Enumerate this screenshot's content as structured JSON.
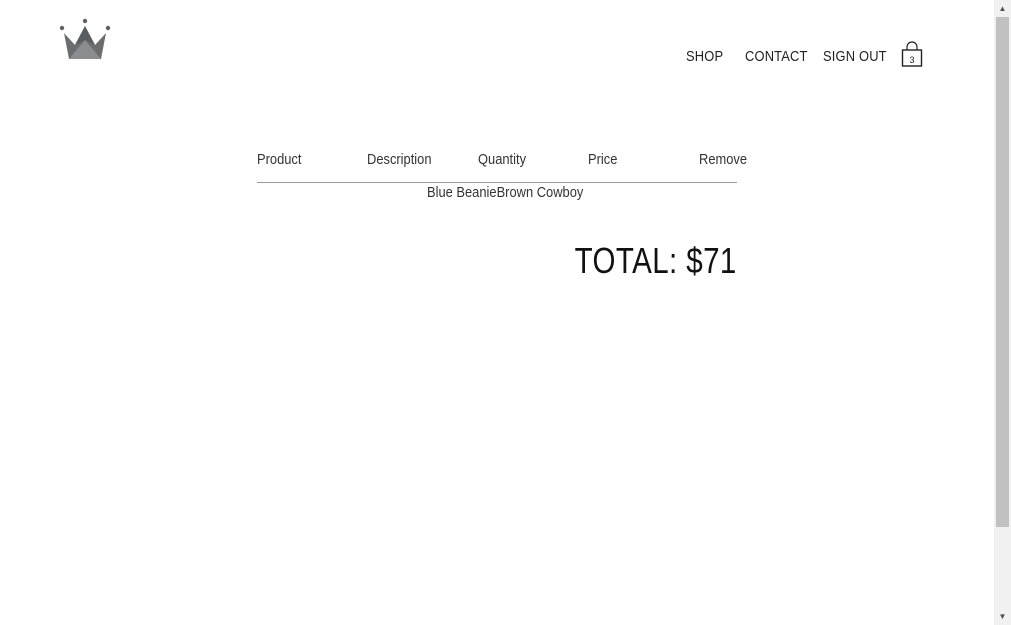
{
  "header": {
    "logo_icon": "crown-icon",
    "nav": {
      "shop": "SHOP",
      "contact": "CONTACT",
      "sign_out": "SIGN OUT"
    },
    "cart": {
      "icon": "shopping-bag-icon",
      "count": "3"
    }
  },
  "checkout": {
    "columns": {
      "product": "Product",
      "description": "Description",
      "quantity": "Quantity",
      "price": "Price",
      "remove": "Remove"
    },
    "items_text": "Blue BeanieBrown Cowboy",
    "total": "TOTAL: $71"
  },
  "scrollbar": {
    "up_icon": "chevron-up-icon",
    "down_icon": "chevron-down-icon"
  },
  "colors": {
    "logo_dark": "#5f6264",
    "logo_light": "#8a8d8f",
    "text": "#222222",
    "divider": "#999999"
  }
}
